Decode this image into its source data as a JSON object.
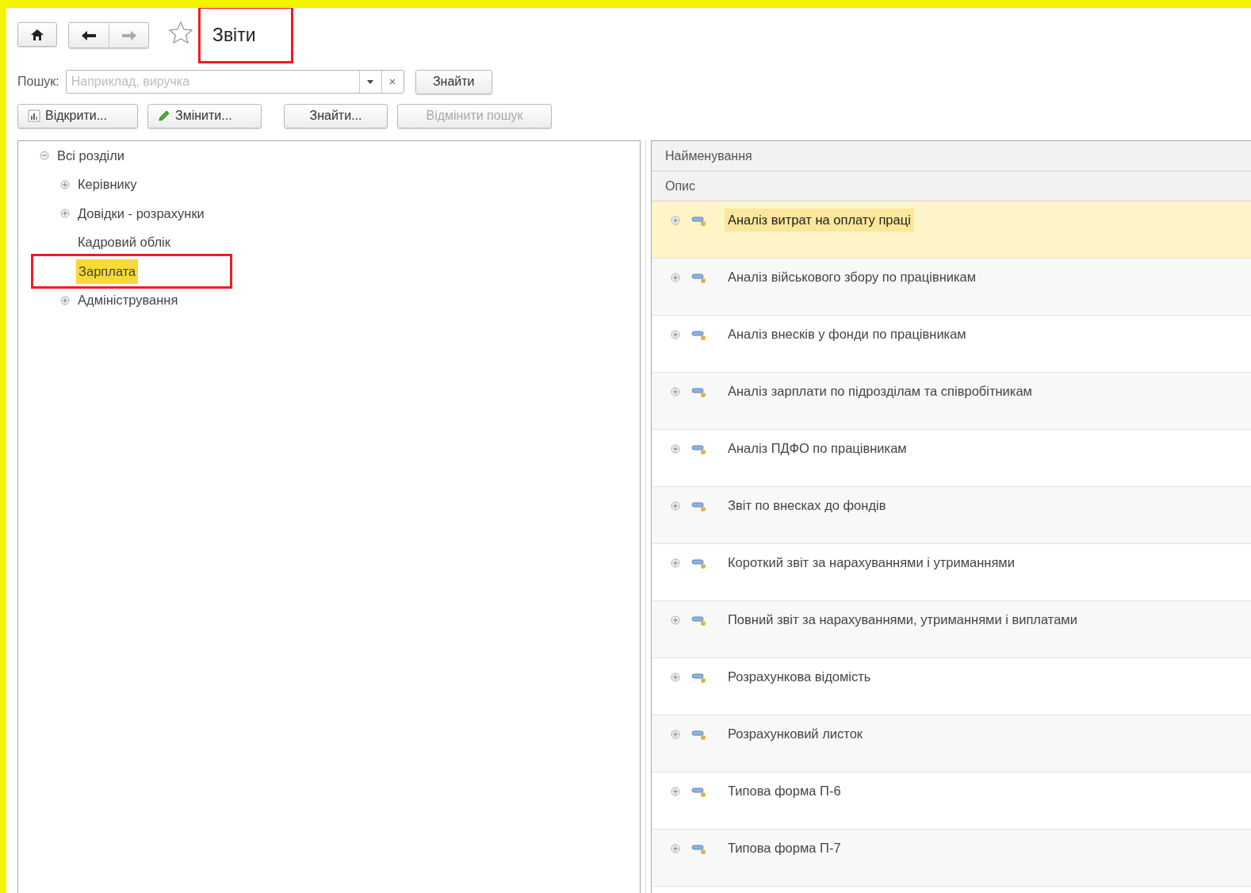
{
  "title": {
    "text": "Звіти",
    "annotated": true,
    "favorite": false
  },
  "search": {
    "label": "Пошук:",
    "placeholder": "Наприклад, виручка",
    "button": "Знайти"
  },
  "actions": [
    {
      "label": "Відкрити...",
      "kind": "open",
      "disabled": false
    },
    {
      "label": "Змінити...",
      "kind": "edit",
      "disabled": false
    },
    {
      "label": "Знайти...",
      "kind": "plain",
      "disabled": false
    },
    {
      "label": "Відмінити пошук",
      "kind": "plain",
      "disabled": true
    }
  ],
  "tree": [
    {
      "label": "Всі розділи",
      "expanded": true,
      "selected": false,
      "annotated": false,
      "children": [
        {
          "label": "Керівнику",
          "expanded": false,
          "selected": false,
          "annotated": false
        },
        {
          "label": "Довідки - розрахунки",
          "expanded": false,
          "selected": false,
          "annotated": false
        },
        {
          "label": "Кадровий облік",
          "selected": false,
          "annotated": false
        },
        {
          "label": "Зарплата",
          "selected": true,
          "annotated": true
        },
        {
          "label": "Адміністрування",
          "expanded": false,
          "selected": false,
          "annotated": false
        }
      ]
    }
  ],
  "table": {
    "columns": [
      "Найменування",
      "Опис"
    ],
    "rows": [
      {
        "name": "Аналіз витрат на оплату праці",
        "selected": true
      },
      {
        "name": "Аналіз військового збору по працівникам",
        "selected": false
      },
      {
        "name": "Аналіз внесків у фонди по працівникам",
        "selected": false
      },
      {
        "name": "Аналіз зарплати по підрозділам та співробітникам",
        "selected": false
      },
      {
        "name": "Аналіз ПДФО по працівникам",
        "selected": false
      },
      {
        "name": "Звіт по внесках до фондів",
        "selected": false
      },
      {
        "name": "Короткий звіт за нарахуваннями і утриманнями",
        "selected": false
      },
      {
        "name": "Повний звіт за нарахуваннями, утриманнями і виплатами",
        "selected": false
      },
      {
        "name": "Розрахункова відомість",
        "selected": false
      },
      {
        "name": "Розрахунковий листок",
        "selected": false
      },
      {
        "name": "Типова форма П-6",
        "selected": false
      },
      {
        "name": "Типова форма П-7",
        "selected": false
      }
    ]
  }
}
